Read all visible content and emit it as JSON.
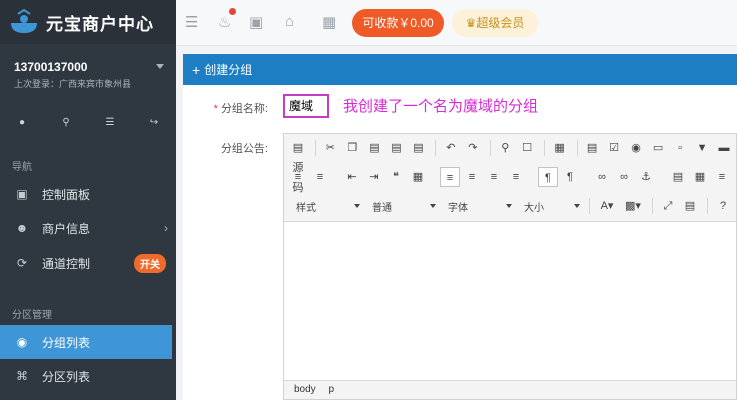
{
  "app": {
    "title": "元宝商户中心"
  },
  "user": {
    "phone": "13700137000",
    "last_login": "上次登录：广西来宾市象州县"
  },
  "sidebar": {
    "section_nav": "导航",
    "section_group": "分区管理",
    "items": [
      {
        "label": "控制面板",
        "icon": "monitor-icon"
      },
      {
        "label": "商户信息",
        "icon": "user-icon"
      },
      {
        "label": "通道控制",
        "icon": "plug-icon",
        "badge": "开关"
      },
      {
        "label": "分组列表",
        "icon": "group-icon"
      },
      {
        "label": "分区列表",
        "icon": "grid-icon"
      }
    ]
  },
  "topbar": {
    "pay_label": "可收款￥0.00",
    "vip_label": "超级会员"
  },
  "panel": {
    "title": "创建分组",
    "name_label": "分组名称:",
    "name_value": "魔域",
    "note": "我创建了一个名为魔域的分组",
    "notice_label": "分组公告:"
  },
  "editor": {
    "source_label": "源码",
    "style_label": "样式",
    "format_label": "普通",
    "font_label": "字体",
    "size_label": "大小",
    "path": [
      "body",
      "p"
    ]
  },
  "colors": {
    "accent": "#1e7ec4",
    "active_nav": "#3e96d6",
    "pay": "#f05a26",
    "note": "#d82bd8"
  }
}
